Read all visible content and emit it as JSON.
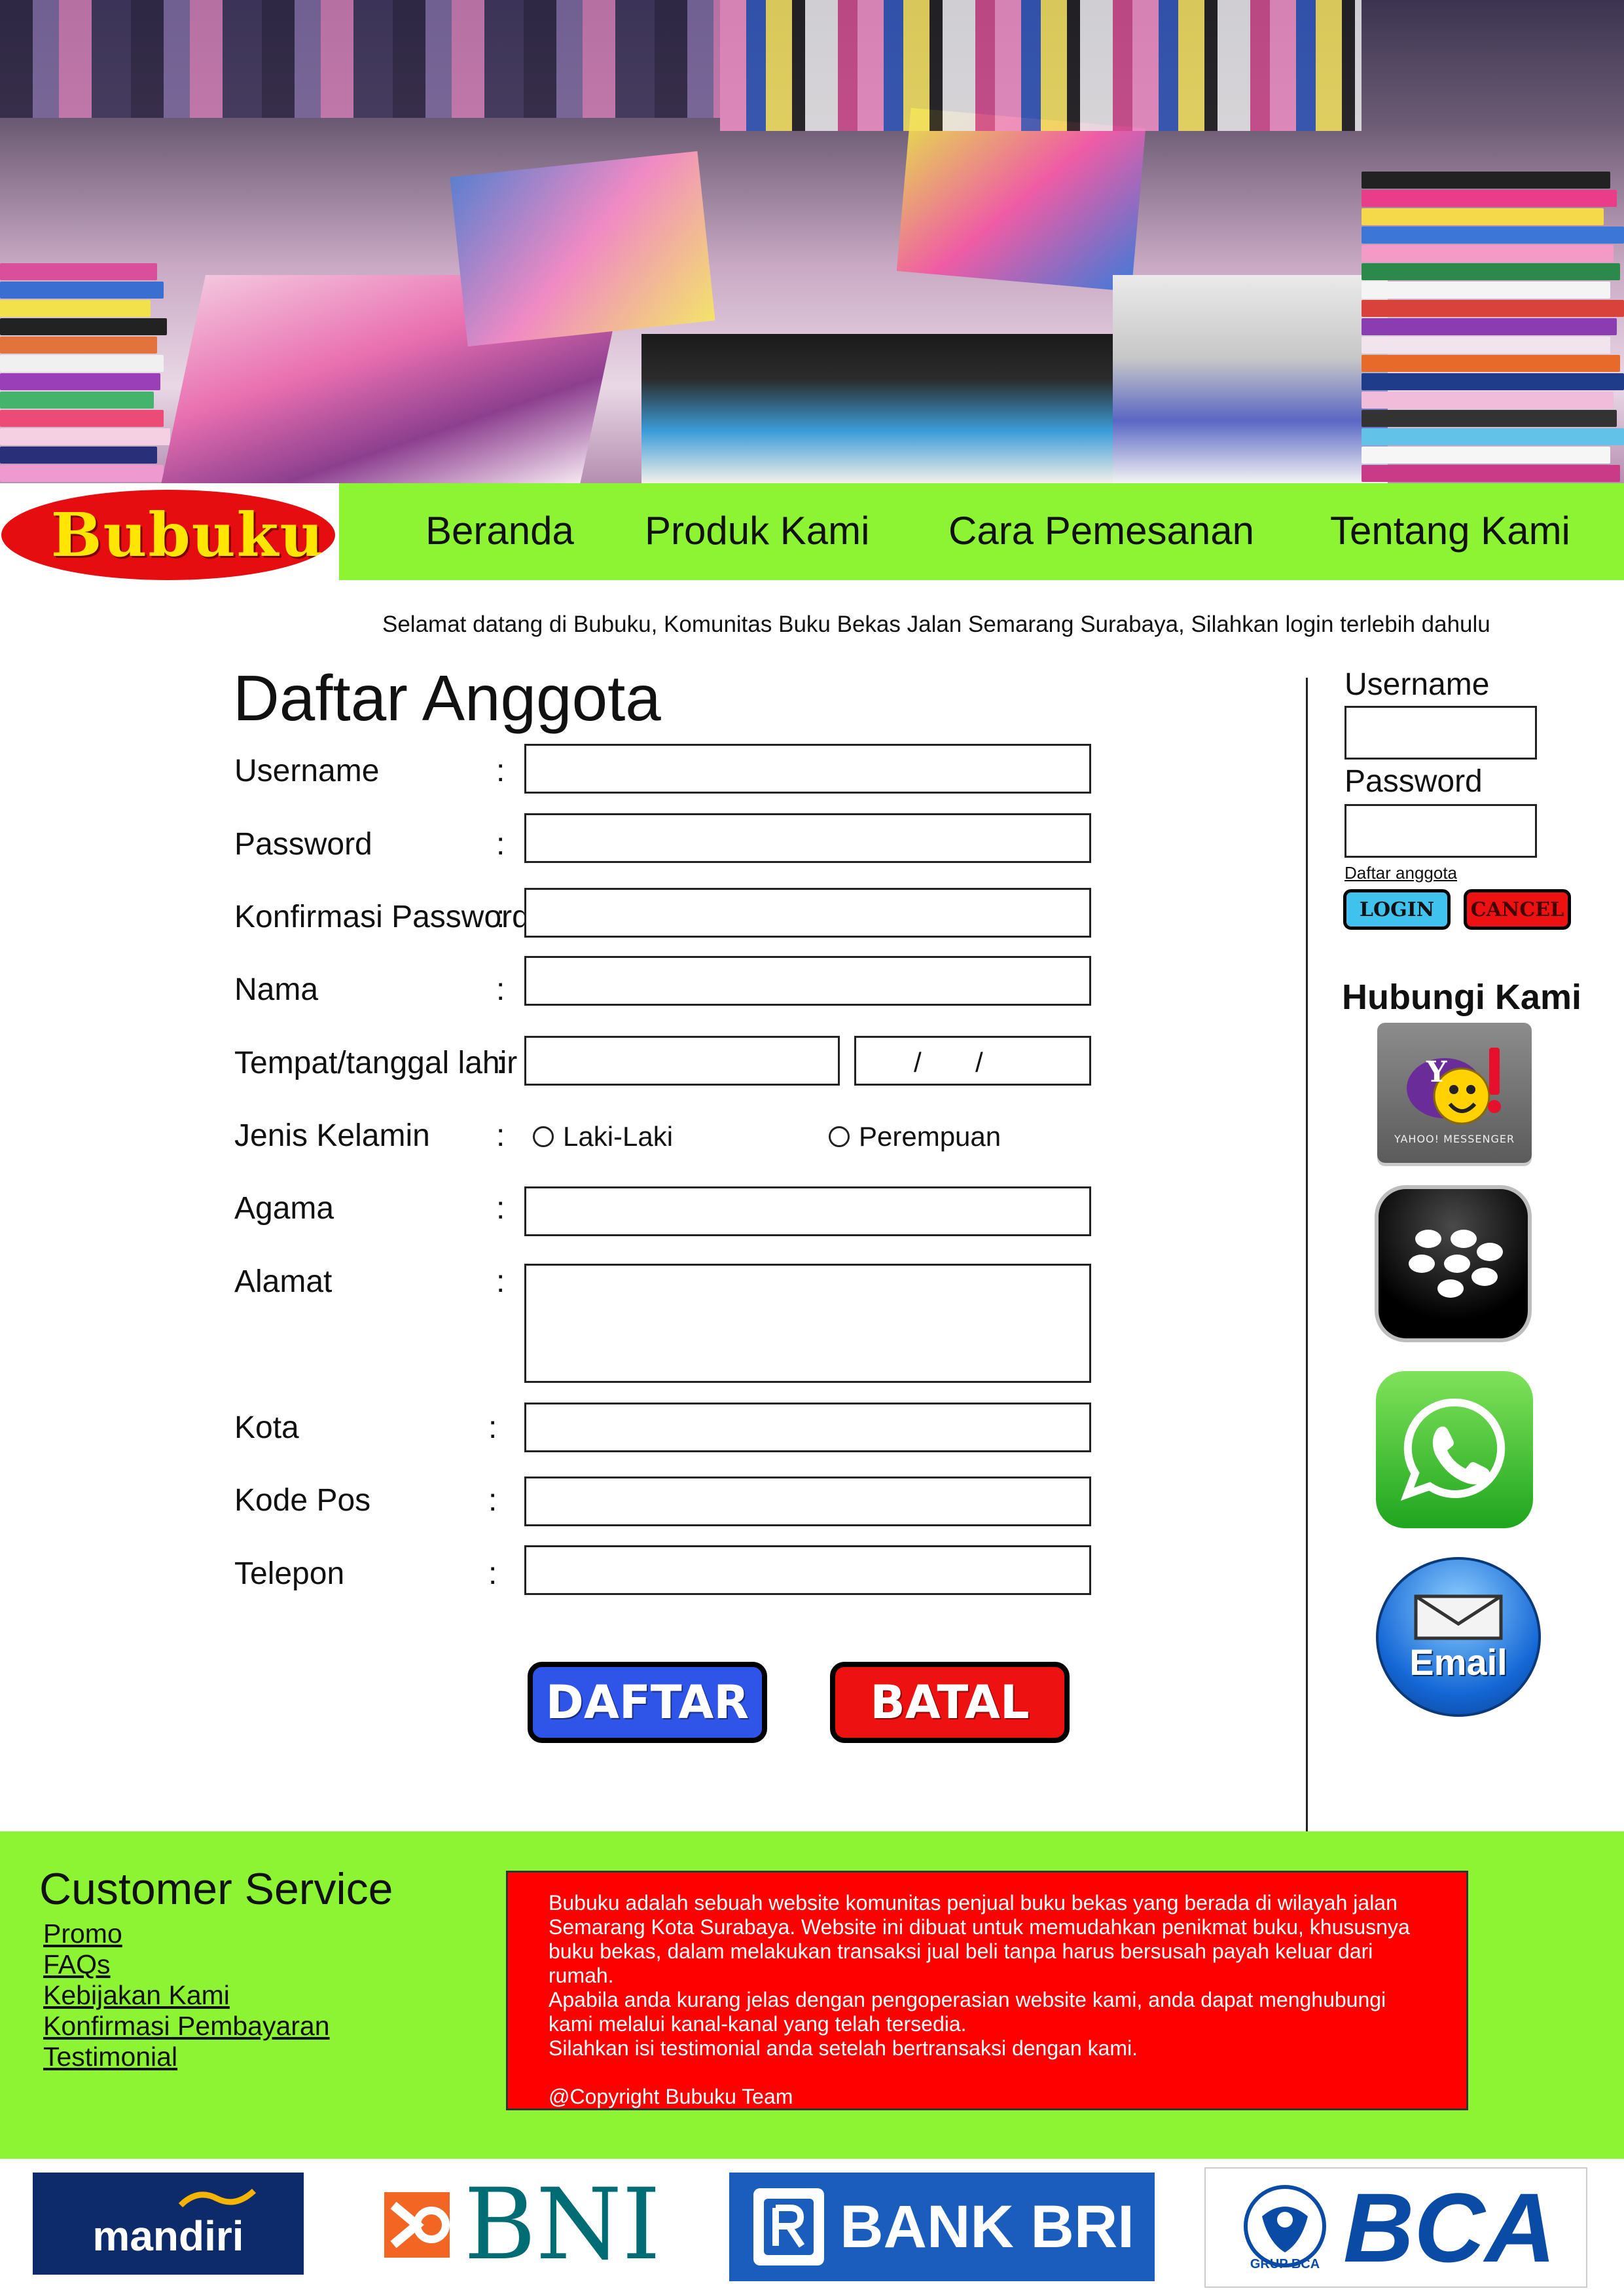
{
  "nav": {
    "logo_text": "Bubuku",
    "items": [
      "Beranda",
      "Produk Kami",
      "Cara Pemesanan",
      "Tentang Kami"
    ]
  },
  "welcome": "Selamat datang di Bubuku, Komunitas Buku Bekas Jalan Semarang Surabaya, Silahkan login terlebih dahulu",
  "form": {
    "title": "Daftar Anggota",
    "colon": ":",
    "date_separator": "/",
    "labels": {
      "username": "Username",
      "password": "Password",
      "confirm": "Konfirmasi Password",
      "name": "Nama",
      "birth": "Tempat/tanggal lahir",
      "gender": "Jenis Kelamin",
      "religion": "Agama",
      "address": "Alamat",
      "city": "Kota",
      "postal": "Kode Pos",
      "phone": "Telepon"
    },
    "gender_options": [
      "Laki-Laki",
      "Perempuan"
    ],
    "submit_label": "DAFTAR",
    "cancel_label": "BATAL"
  },
  "sidebar": {
    "username_label": "Username",
    "password_label": "Password",
    "register_link": "Daftar anggota",
    "login_label": "LOGIN",
    "cancel_label": "CANCEL",
    "contact_title": "Hubungi Kami",
    "yahoo_caption": "YAHOO! MESSENGER",
    "email_label": "Email"
  },
  "footer": {
    "cs_title": "Customer Service",
    "links": [
      "Promo",
      "FAQs",
      "Kebijakan Kami",
      "Konfirmasi Pembayaran",
      "Testimonial"
    ],
    "info": "Bubuku adalah sebuah website komunitas penjual buku bekas yang berada di wilayah jalan\nSemarang Kota Surabaya. Website ini dibuat untuk memudahkan penikmat buku, khususnya\nbuku bekas, dalam melakukan transaksi jual beli tanpa harus bersusah payah keluar dari\nrumah.\nApabila anda kurang jelas dengan pengoperasian website kami, anda dapat menghubungi\nkami melalui kanal-kanal yang telah tersedia.\nSilahkan isi testimonial anda setelah bertransaksi dengan kami.\n\n@Copyright Bubuku Team"
  },
  "banks": {
    "mandiri": "mandiri",
    "bni": "BNI",
    "bri": "BANK BRI",
    "bca": "BCA",
    "bca_sub": "GRUP BCA"
  },
  "colors": {
    "nav_green": "#8cf433",
    "logo_red": "#e60d10",
    "logo_yellow": "#ffe600",
    "info_red": "#ff0000",
    "daftar_blue": "#2f55e8",
    "batal_red": "#ee1111",
    "login_cyan": "#3fc3ee",
    "cancel_red": "#ee1111"
  }
}
